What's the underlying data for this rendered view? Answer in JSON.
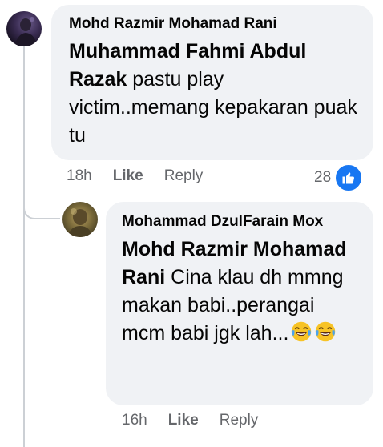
{
  "comment": {
    "author": "Mohd Razmir Mohamad Rani",
    "mention": "Muhammad Fahmi Abdul Razak",
    "text": " pastu play victim..memang kepakaran puak tu",
    "time": "18h",
    "like_label": "Like",
    "reply_label": "Reply",
    "reaction_count": "28",
    "reaction_icon": "thumbs-up-icon",
    "accent_color": "#1877f2"
  },
  "reply": {
    "author": "Mohammad DzulFarain Mox",
    "mention": "Mohd Razmir Mohamad Rani",
    "text": " Cina klau dh mmng makan babi..perangai mcm babi jgk lah...",
    "emojis": [
      "laughing-with-tears-emoji",
      "laughing-with-tears-emoji"
    ],
    "time": "16h",
    "like_label": "Like",
    "reply_label": "Reply"
  }
}
